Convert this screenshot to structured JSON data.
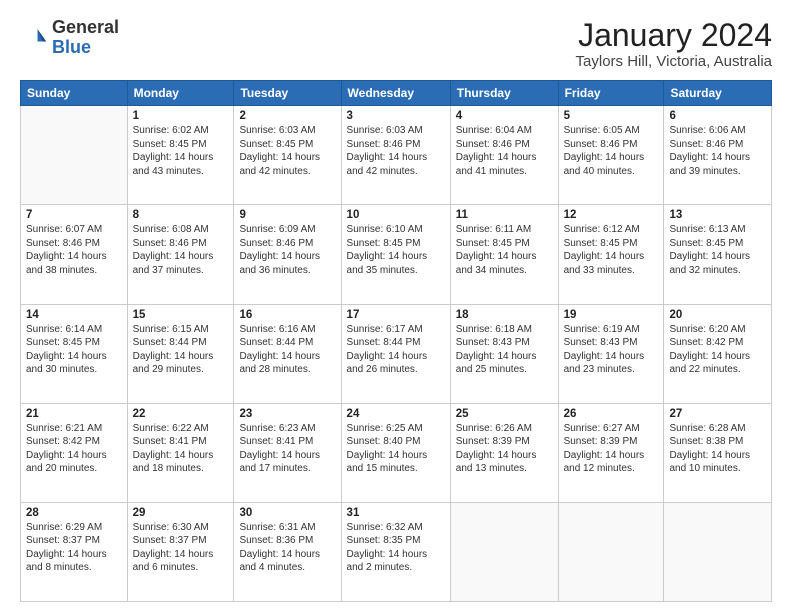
{
  "header": {
    "logo_general": "General",
    "logo_blue": "Blue",
    "month_year": "January 2024",
    "location": "Taylors Hill, Victoria, Australia"
  },
  "days_of_week": [
    "Sunday",
    "Monday",
    "Tuesday",
    "Wednesday",
    "Thursday",
    "Friday",
    "Saturday"
  ],
  "weeks": [
    [
      {
        "day": "",
        "info": ""
      },
      {
        "day": "1",
        "info": "Sunrise: 6:02 AM\nSunset: 8:45 PM\nDaylight: 14 hours\nand 43 minutes."
      },
      {
        "day": "2",
        "info": "Sunrise: 6:03 AM\nSunset: 8:45 PM\nDaylight: 14 hours\nand 42 minutes."
      },
      {
        "day": "3",
        "info": "Sunrise: 6:03 AM\nSunset: 8:46 PM\nDaylight: 14 hours\nand 42 minutes."
      },
      {
        "day": "4",
        "info": "Sunrise: 6:04 AM\nSunset: 8:46 PM\nDaylight: 14 hours\nand 41 minutes."
      },
      {
        "day": "5",
        "info": "Sunrise: 6:05 AM\nSunset: 8:46 PM\nDaylight: 14 hours\nand 40 minutes."
      },
      {
        "day": "6",
        "info": "Sunrise: 6:06 AM\nSunset: 8:46 PM\nDaylight: 14 hours\nand 39 minutes."
      }
    ],
    [
      {
        "day": "7",
        "info": "Sunrise: 6:07 AM\nSunset: 8:46 PM\nDaylight: 14 hours\nand 38 minutes."
      },
      {
        "day": "8",
        "info": "Sunrise: 6:08 AM\nSunset: 8:46 PM\nDaylight: 14 hours\nand 37 minutes."
      },
      {
        "day": "9",
        "info": "Sunrise: 6:09 AM\nSunset: 8:46 PM\nDaylight: 14 hours\nand 36 minutes."
      },
      {
        "day": "10",
        "info": "Sunrise: 6:10 AM\nSunset: 8:45 PM\nDaylight: 14 hours\nand 35 minutes."
      },
      {
        "day": "11",
        "info": "Sunrise: 6:11 AM\nSunset: 8:45 PM\nDaylight: 14 hours\nand 34 minutes."
      },
      {
        "day": "12",
        "info": "Sunrise: 6:12 AM\nSunset: 8:45 PM\nDaylight: 14 hours\nand 33 minutes."
      },
      {
        "day": "13",
        "info": "Sunrise: 6:13 AM\nSunset: 8:45 PM\nDaylight: 14 hours\nand 32 minutes."
      }
    ],
    [
      {
        "day": "14",
        "info": "Sunrise: 6:14 AM\nSunset: 8:45 PM\nDaylight: 14 hours\nand 30 minutes."
      },
      {
        "day": "15",
        "info": "Sunrise: 6:15 AM\nSunset: 8:44 PM\nDaylight: 14 hours\nand 29 minutes."
      },
      {
        "day": "16",
        "info": "Sunrise: 6:16 AM\nSunset: 8:44 PM\nDaylight: 14 hours\nand 28 minutes."
      },
      {
        "day": "17",
        "info": "Sunrise: 6:17 AM\nSunset: 8:44 PM\nDaylight: 14 hours\nand 26 minutes."
      },
      {
        "day": "18",
        "info": "Sunrise: 6:18 AM\nSunset: 8:43 PM\nDaylight: 14 hours\nand 25 minutes."
      },
      {
        "day": "19",
        "info": "Sunrise: 6:19 AM\nSunset: 8:43 PM\nDaylight: 14 hours\nand 23 minutes."
      },
      {
        "day": "20",
        "info": "Sunrise: 6:20 AM\nSunset: 8:42 PM\nDaylight: 14 hours\nand 22 minutes."
      }
    ],
    [
      {
        "day": "21",
        "info": "Sunrise: 6:21 AM\nSunset: 8:42 PM\nDaylight: 14 hours\nand 20 minutes."
      },
      {
        "day": "22",
        "info": "Sunrise: 6:22 AM\nSunset: 8:41 PM\nDaylight: 14 hours\nand 18 minutes."
      },
      {
        "day": "23",
        "info": "Sunrise: 6:23 AM\nSunset: 8:41 PM\nDaylight: 14 hours\nand 17 minutes."
      },
      {
        "day": "24",
        "info": "Sunrise: 6:25 AM\nSunset: 8:40 PM\nDaylight: 14 hours\nand 15 minutes."
      },
      {
        "day": "25",
        "info": "Sunrise: 6:26 AM\nSunset: 8:39 PM\nDaylight: 14 hours\nand 13 minutes."
      },
      {
        "day": "26",
        "info": "Sunrise: 6:27 AM\nSunset: 8:39 PM\nDaylight: 14 hours\nand 12 minutes."
      },
      {
        "day": "27",
        "info": "Sunrise: 6:28 AM\nSunset: 8:38 PM\nDaylight: 14 hours\nand 10 minutes."
      }
    ],
    [
      {
        "day": "28",
        "info": "Sunrise: 6:29 AM\nSunset: 8:37 PM\nDaylight: 14 hours\nand 8 minutes."
      },
      {
        "day": "29",
        "info": "Sunrise: 6:30 AM\nSunset: 8:37 PM\nDaylight: 14 hours\nand 6 minutes."
      },
      {
        "day": "30",
        "info": "Sunrise: 6:31 AM\nSunset: 8:36 PM\nDaylight: 14 hours\nand 4 minutes."
      },
      {
        "day": "31",
        "info": "Sunrise: 6:32 AM\nSunset: 8:35 PM\nDaylight: 14 hours\nand 2 minutes."
      },
      {
        "day": "",
        "info": ""
      },
      {
        "day": "",
        "info": ""
      },
      {
        "day": "",
        "info": ""
      }
    ]
  ]
}
